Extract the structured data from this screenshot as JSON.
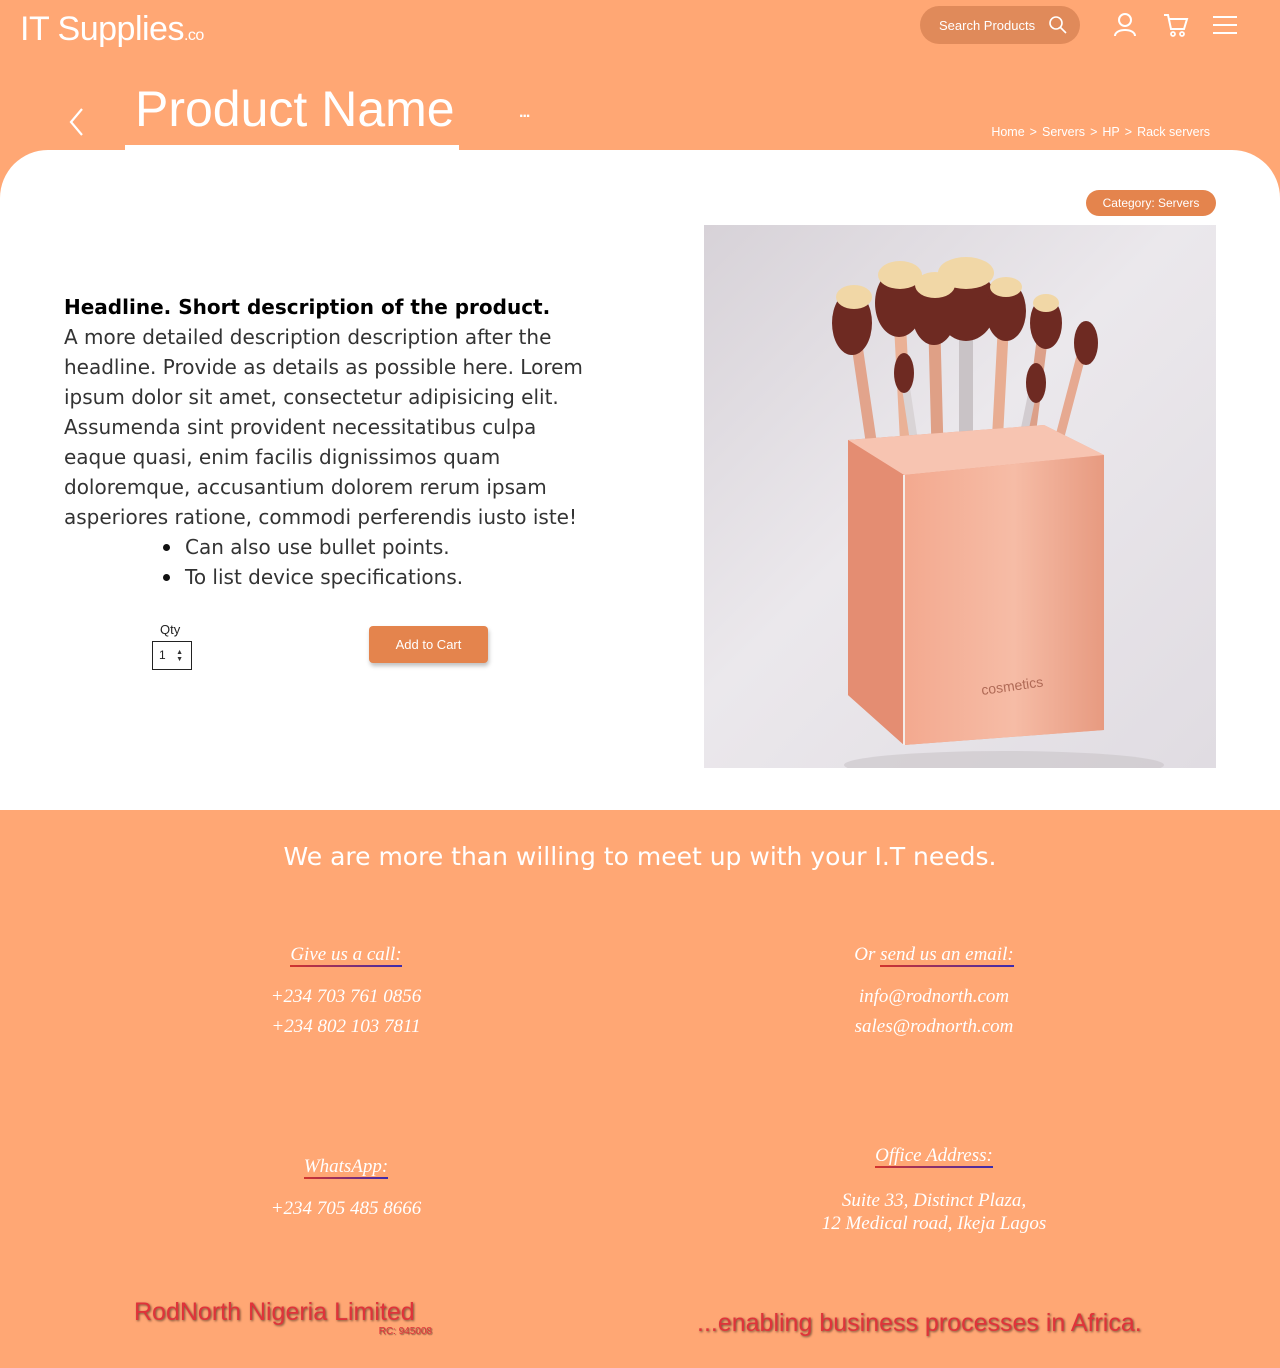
{
  "header": {
    "logo_main": "IT Supplies",
    "logo_tld": ".co",
    "search_placeholder": "Search Products",
    "icons": [
      "search-icon",
      "user-icon",
      "cart-icon",
      "menu-icon"
    ]
  },
  "titlebar": {
    "title": "Product Name",
    "more": "...",
    "breadcrumb": [
      "Home",
      ">",
      "Servers",
      ">",
      "HP",
      ">",
      "Rack servers"
    ]
  },
  "product": {
    "category": "Category: Servers",
    "headline": "Headline. Short description of the product.",
    "description": "A more detailed description description after the headline. Provide as details as possible here. Lorem ipsum dolor sit amet, consectetur adipisicing elit. Assumenda sint provident necessitatibus culpa eaque quasi, enim facilis dignissimos quam doloremque, accusantium dolorem rerum ipsam asperiores ratione, commodi perferendis iusto iste!",
    "bullets": [
      "Can also use bullet points.",
      "To list device specifications."
    ],
    "qty_label": "Qty",
    "qty_value": "1",
    "add_to_cart": "Add to Cart",
    "image_brand": "cosmetics"
  },
  "footer": {
    "tagline": "We are more than willing to meet up with your I.T needs.",
    "call": {
      "heading": "Give us a call:",
      "lines": [
        "+234 703 761 0856",
        "+234 802 103 7811"
      ]
    },
    "email": {
      "prefix": "Or ",
      "heading": "send us an email:",
      "lines": [
        "info@rodnorth.com",
        "sales@rodnorth.com"
      ]
    },
    "whatsapp": {
      "heading": "WhatsApp:",
      "lines": [
        "+234 705 485 8666"
      ]
    },
    "office": {
      "heading": "Office Address:",
      "lines": [
        "Suite 33, Distinct Plaza,",
        "12 Medical road, Ikeja Lagos"
      ]
    },
    "company": "RodNorth Nigeria Limited",
    "rc": "RC: 945008",
    "slogan": "...enabling business processes in Africa."
  },
  "colors": {
    "background": "#ffa774",
    "accent": "#e4844d",
    "search_bg": "#e08a5a",
    "brand_red": "#e0333a"
  }
}
